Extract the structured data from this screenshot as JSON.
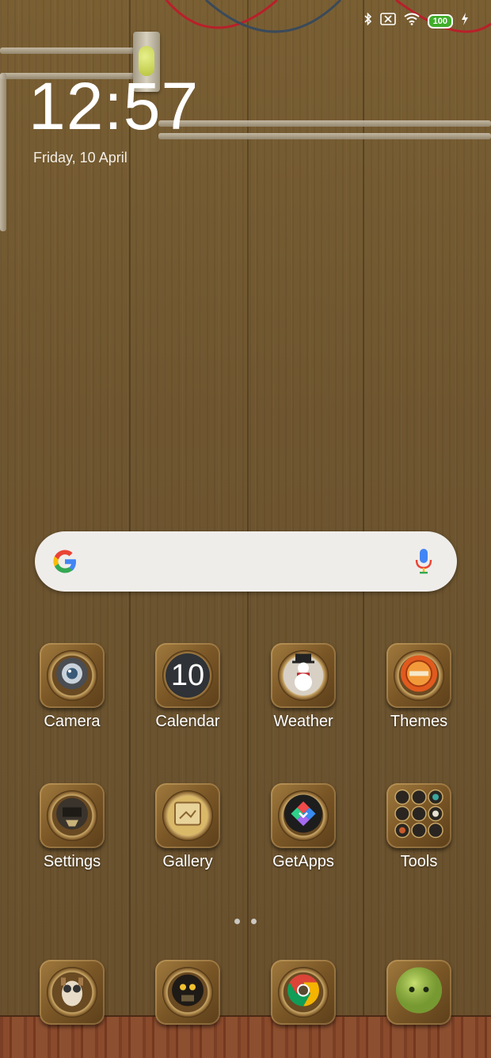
{
  "status_bar": {
    "battery": "100",
    "icons": [
      "bluetooth-icon",
      "no-sim-icon",
      "wifi-icon",
      "battery-icon",
      "charging-icon"
    ]
  },
  "lockclock": {
    "time": "12:57",
    "date": "Friday, 10 April"
  },
  "search_bar": {
    "logo": "google-g-icon",
    "mic": "microphone-icon"
  },
  "apps": [
    {
      "label": "Camera",
      "icon": "camera-icon"
    },
    {
      "label": "Calendar",
      "icon": "calendar-icon",
      "badge": "10"
    },
    {
      "label": "Weather",
      "icon": "weather-snowman-icon"
    },
    {
      "label": "Themes",
      "icon": "themes-icon"
    },
    {
      "label": "Settings",
      "icon": "settings-icon"
    },
    {
      "label": "Gallery",
      "icon": "gallery-icon"
    },
    {
      "label": "GetApps",
      "icon": "getapps-icon"
    },
    {
      "label": "Tools",
      "icon": "tools-folder-icon"
    }
  ],
  "dock": [
    {
      "icon": "dog-with-glasses-icon"
    },
    {
      "icon": "robot-icon"
    },
    {
      "icon": "chrome-browser-icon"
    },
    {
      "icon": "green-messaging-icon"
    }
  ],
  "page_indicator": {
    "pages": 2,
    "current": 1
  }
}
